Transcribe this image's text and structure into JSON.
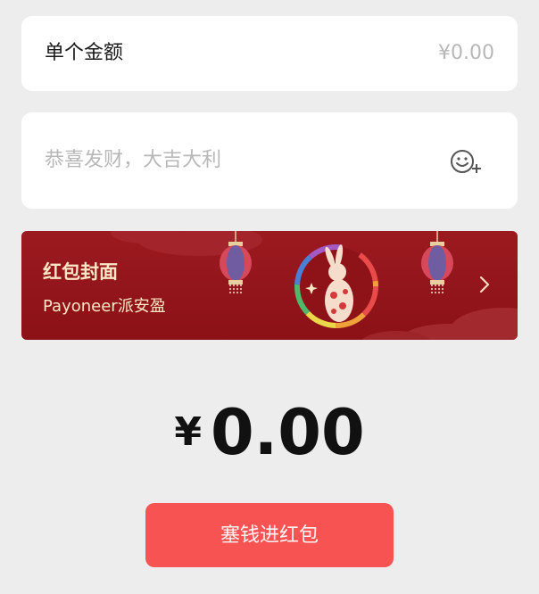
{
  "amount": {
    "label": "单个金额",
    "placeholder": "¥0.00"
  },
  "blessing": {
    "placeholder": "恭喜发财，大吉大利",
    "emoji_icon": "emoji-add-icon"
  },
  "cover": {
    "title": "红包封面",
    "subtitle": "Payoneer派安盈",
    "decorations": [
      "lantern-icon",
      "rabbit-illustration",
      "lantern-icon"
    ],
    "chevron_icon": "chevron-right-icon",
    "accent_color": "#8b1117"
  },
  "total": {
    "currency_symbol": "¥",
    "value": "0.00"
  },
  "submit": {
    "label": "塞钱进红包",
    "color": "#f75353"
  }
}
